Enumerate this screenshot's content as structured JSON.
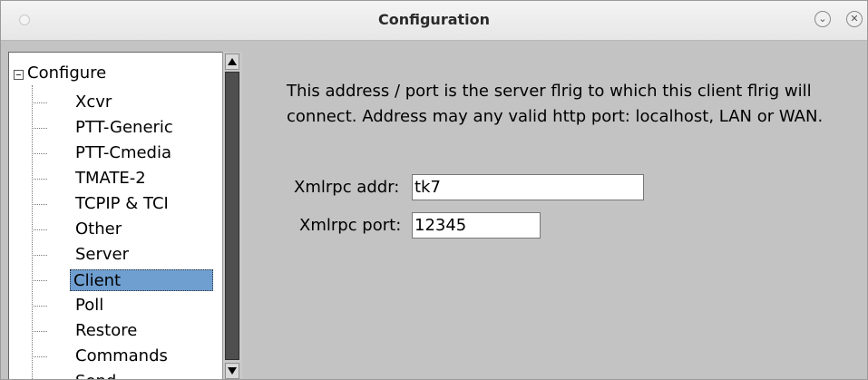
{
  "window": {
    "title": "Configuration"
  },
  "tree": {
    "root_label": "Configure",
    "items": [
      {
        "label": "Xcvr"
      },
      {
        "label": "PTT-Generic"
      },
      {
        "label": "PTT-Cmedia"
      },
      {
        "label": "TMATE-2"
      },
      {
        "label": "TCPIP & TCI"
      },
      {
        "label": "Other"
      },
      {
        "label": "Server"
      },
      {
        "label": "Client",
        "selected": true
      },
      {
        "label": "Poll"
      },
      {
        "label": "Restore"
      },
      {
        "label": "Commands"
      },
      {
        "label": "Send"
      }
    ]
  },
  "client_panel": {
    "description": "This address / port is the server flrig to which this client flrig will connect.  Address may any valid http port: localhost, LAN or WAN.",
    "addr_label": "Xmlrpc addr:",
    "addr_value": "tk7",
    "port_label": "Xmlrpc port:",
    "port_value": "12345"
  },
  "colors": {
    "selection": "#6f9fd1",
    "panel_bg": "#c3c3c3"
  }
}
